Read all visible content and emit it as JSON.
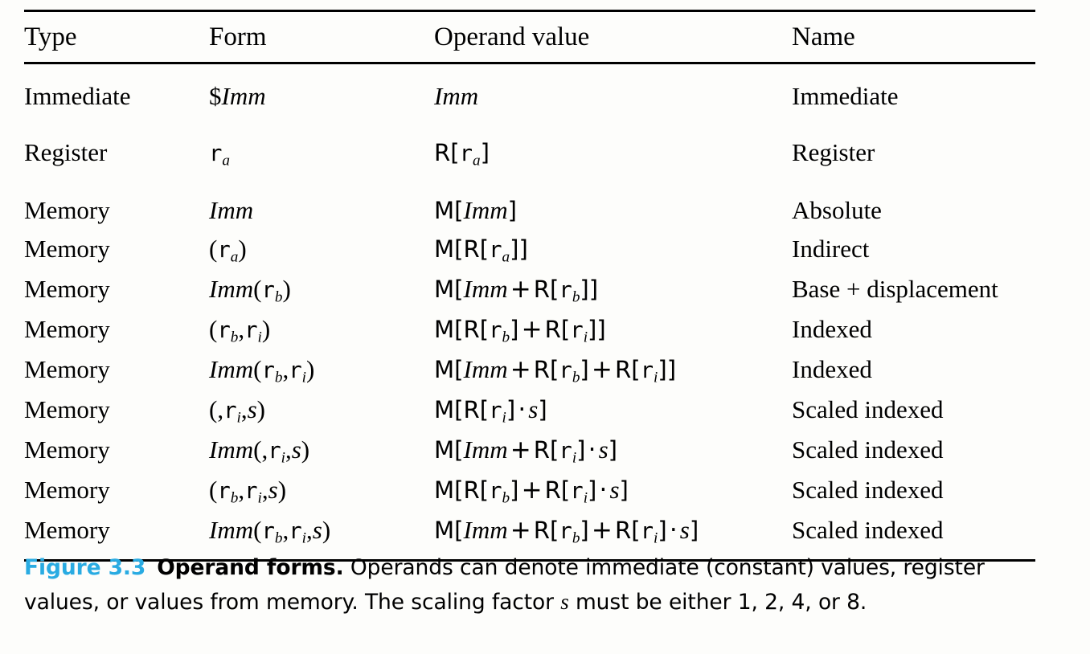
{
  "figure": {
    "label": "Figure 3.3",
    "title": "Operand forms.",
    "caption_part1": "Operands can denote immediate (constant) values, register values, or values from memory. The scaling factor ",
    "caption_italic": "s",
    "caption_part2": " must be either 1, 2, 4, or 8.",
    "label_color": "#29abe2"
  },
  "table": {
    "headers": {
      "type": "Type",
      "form": "Form",
      "operand": "Operand value",
      "name": "Name"
    },
    "rows": [
      {
        "type": "Immediate",
        "form_text": "$Imm",
        "operand_text": "Imm",
        "name": "Immediate"
      },
      {
        "type": "Register",
        "form_text": "ra",
        "operand_text": "R[ra]",
        "name": "Register"
      },
      {
        "type": "Memory",
        "form_text": "Imm",
        "operand_text": "M[Imm]",
        "name": "Absolute"
      },
      {
        "type": "Memory",
        "form_text": "(ra)",
        "operand_text": "M[R[ra]]",
        "name": "Indirect"
      },
      {
        "type": "Memory",
        "form_text": "Imm(rb)",
        "operand_text": "M[Imm + R[rb]]",
        "name": "Base + displacement"
      },
      {
        "type": "Memory",
        "form_text": "(rb,ri)",
        "operand_text": "M[R[rb] + R[ri]]",
        "name": "Indexed"
      },
      {
        "type": "Memory",
        "form_text": "Imm(rb,ri)",
        "operand_text": "M[Imm + R[rb] + R[ri]]",
        "name": "Indexed"
      },
      {
        "type": "Memory",
        "form_text": "(,ri,s)",
        "operand_text": "M[R[ri] · s]",
        "name": "Scaled indexed"
      },
      {
        "type": "Memory",
        "form_text": "Imm(,ri,s)",
        "operand_text": "M[Imm + R[ri] · s]",
        "name": "Scaled indexed"
      },
      {
        "type": "Memory",
        "form_text": "(rb,ri,s)",
        "operand_text": "M[R[rb] + R[ri] · s]",
        "name": "Scaled indexed"
      },
      {
        "type": "Memory",
        "form_text": "Imm(rb,ri,s)",
        "operand_text": "M[Imm + R[rb] + R[ri] · s]",
        "name": "Scaled indexed"
      }
    ]
  }
}
